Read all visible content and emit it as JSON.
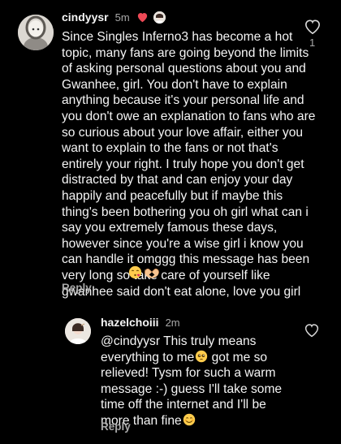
{
  "comments": [
    {
      "username": "cindyysr",
      "time": "5m",
      "creator_heart_icon": "red-heart-icon",
      "text": "Since Singles Inferno3 has become a hot topic, many fans are going beyond the limits of asking personal questions about you and Gwanhee, girl. You don't have to explain anything because it's your personal life and you don't owe an explanation to fans who are so curious about your love affair, either you want to explain to the fans or not that's entirely your right. I truly hope you don't get distracted by that and can enjoy your day happily and peacefully but if maybe this thing's been bothering you oh girl what can i say you extremely famous these days, however since you're a wise girl i know you can handle it omggg this message has been very long so take care of yourself like gwanhee said don't eat alone, love you girl",
      "reply_label": "Reply",
      "like_count": "1"
    },
    {
      "username": "hazelchoiii",
      "time": "2m",
      "text_part1": "@cindyysr This truly means everything to me",
      "text_part2": " got me so relieved! Tysm for such a warm message :-) guess I'll take some time off the internet and I'll be more than fine",
      "reply_label": "Reply"
    }
  ],
  "colors": {
    "background": "#000000",
    "text": "#f5f5f5",
    "muted": "#a8a8a8",
    "heart_red": "#ed4956"
  }
}
